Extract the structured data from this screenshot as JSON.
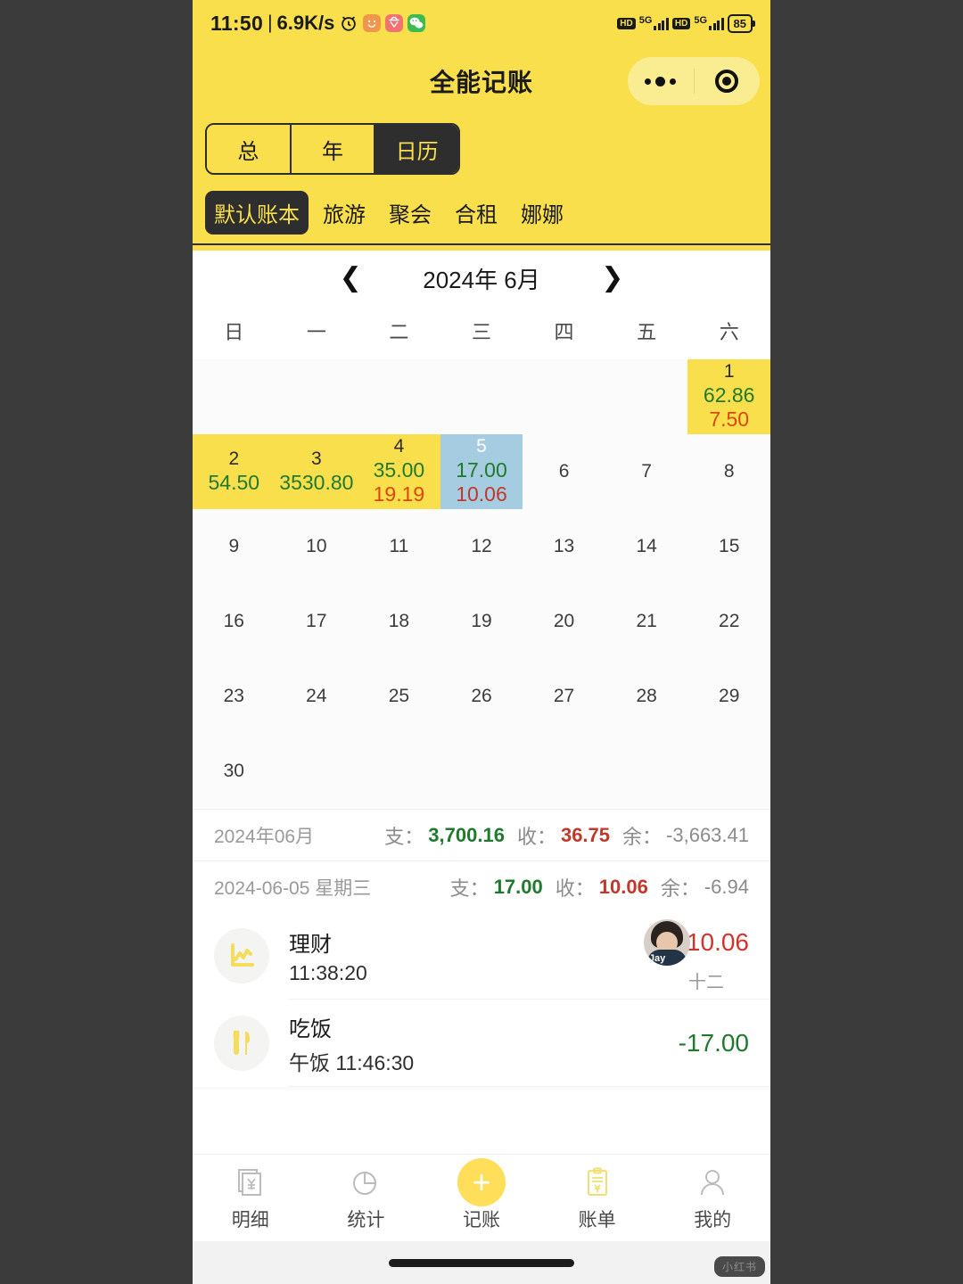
{
  "status_bar": {
    "time": "11:50",
    "separator": "|",
    "net_speed": "6.9K/s",
    "icons": [
      "alarm-clock-icon",
      "orange-app-icon",
      "red-app-icon",
      "wechat-icon"
    ],
    "hd_label": "HD",
    "network_label": "5G",
    "battery": "85"
  },
  "header": {
    "title": "全能记账",
    "capsule": {
      "menu": "more-dots-icon",
      "close": "target-circle-icon"
    },
    "segments": [
      {
        "label": "总",
        "active": false
      },
      {
        "label": "年",
        "active": false
      },
      {
        "label": "日历",
        "active": true
      }
    ],
    "books": [
      {
        "label": "默认账本",
        "active": true
      },
      {
        "label": "旅游",
        "active": false
      },
      {
        "label": "聚会",
        "active": false
      },
      {
        "label": "合租",
        "active": false
      },
      {
        "label": "娜娜",
        "active": false
      }
    ]
  },
  "calendar": {
    "prev_label": "❮",
    "next_label": "❯",
    "month_label": "2024年 6月",
    "weekdays": [
      "日",
      "一",
      "二",
      "三",
      "四",
      "五",
      "六"
    ],
    "cells": [
      {
        "day": "",
        "income": "",
        "expense": "",
        "state": "empty"
      },
      {
        "day": "",
        "income": "",
        "expense": "",
        "state": "empty"
      },
      {
        "day": "",
        "income": "",
        "expense": "",
        "state": "empty"
      },
      {
        "day": "",
        "income": "",
        "expense": "",
        "state": "empty"
      },
      {
        "day": "",
        "income": "",
        "expense": "",
        "state": "empty"
      },
      {
        "day": "",
        "income": "",
        "expense": "",
        "state": "empty"
      },
      {
        "day": "1",
        "income": "62.86",
        "expense": "7.50",
        "state": "hl"
      },
      {
        "day": "2",
        "income": "54.50",
        "expense": "",
        "state": "hl"
      },
      {
        "day": "3",
        "income": "3530.80",
        "expense": "",
        "state": "hl"
      },
      {
        "day": "4",
        "income": "35.00",
        "expense": "19.19",
        "state": "hl"
      },
      {
        "day": "5",
        "income": "17.00",
        "expense": "10.06",
        "state": "sel"
      },
      {
        "day": "6",
        "income": "",
        "expense": "",
        "state": ""
      },
      {
        "day": "7",
        "income": "",
        "expense": "",
        "state": ""
      },
      {
        "day": "8",
        "income": "",
        "expense": "",
        "state": ""
      },
      {
        "day": "9",
        "income": "",
        "expense": "",
        "state": ""
      },
      {
        "day": "10",
        "income": "",
        "expense": "",
        "state": ""
      },
      {
        "day": "11",
        "income": "",
        "expense": "",
        "state": ""
      },
      {
        "day": "12",
        "income": "",
        "expense": "",
        "state": ""
      },
      {
        "day": "13",
        "income": "",
        "expense": "",
        "state": ""
      },
      {
        "day": "14",
        "income": "",
        "expense": "",
        "state": ""
      },
      {
        "day": "15",
        "income": "",
        "expense": "",
        "state": ""
      },
      {
        "day": "16",
        "income": "",
        "expense": "",
        "state": ""
      },
      {
        "day": "17",
        "income": "",
        "expense": "",
        "state": ""
      },
      {
        "day": "18",
        "income": "",
        "expense": "",
        "state": ""
      },
      {
        "day": "19",
        "income": "",
        "expense": "",
        "state": ""
      },
      {
        "day": "20",
        "income": "",
        "expense": "",
        "state": ""
      },
      {
        "day": "21",
        "income": "",
        "expense": "",
        "state": ""
      },
      {
        "day": "22",
        "income": "",
        "expense": "",
        "state": ""
      },
      {
        "day": "23",
        "income": "",
        "expense": "",
        "state": ""
      },
      {
        "day": "24",
        "income": "",
        "expense": "",
        "state": ""
      },
      {
        "day": "25",
        "income": "",
        "expense": "",
        "state": ""
      },
      {
        "day": "26",
        "income": "",
        "expense": "",
        "state": ""
      },
      {
        "day": "27",
        "income": "",
        "expense": "",
        "state": ""
      },
      {
        "day": "28",
        "income": "",
        "expense": "",
        "state": ""
      },
      {
        "day": "29",
        "income": "",
        "expense": "",
        "state": ""
      },
      {
        "day": "30",
        "income": "",
        "expense": "",
        "state": ""
      },
      {
        "day": "",
        "income": "",
        "expense": "",
        "state": "empty"
      },
      {
        "day": "",
        "income": "",
        "expense": "",
        "state": "empty"
      },
      {
        "day": "",
        "income": "",
        "expense": "",
        "state": "empty"
      },
      {
        "day": "",
        "income": "",
        "expense": "",
        "state": "empty"
      },
      {
        "day": "",
        "income": "",
        "expense": "",
        "state": "empty"
      },
      {
        "day": "",
        "income": "",
        "expense": "",
        "state": "empty"
      }
    ]
  },
  "month_summary": {
    "date": "2024年06月",
    "expense_label": "支：",
    "expense_value": "3,700.16",
    "income_label": "收：",
    "income_value": "36.75",
    "balance_label": "余：",
    "balance_value": "-3,663.41"
  },
  "day_summary": {
    "date": "2024-06-05 星期三",
    "expense_label": "支：",
    "expense_value": "17.00",
    "income_label": "收：",
    "income_value": "10.06",
    "balance_label": "余：",
    "balance_value": "-6.94"
  },
  "transactions": [
    {
      "icon": "line-chart-icon",
      "name": "理财",
      "sub": "11:38:20",
      "amount": "10.06",
      "amount_type": "income",
      "avatar_tag": "Jay",
      "note": "十二"
    },
    {
      "icon": "cutlery-icon",
      "name": "吃饭",
      "sub": "午饭 11:46:30",
      "amount": "-17.00",
      "amount_type": "expense",
      "avatar_tag": "",
      "note": ""
    }
  ],
  "tabbar": [
    {
      "icon": "receipt-yen-icon",
      "label": "明细",
      "active": false
    },
    {
      "icon": "pie-chart-icon",
      "label": "统计",
      "active": false
    },
    {
      "icon": "plus-icon",
      "label": "记账",
      "active": true
    },
    {
      "icon": "clipboard-yen-icon",
      "label": "账单",
      "active": false
    },
    {
      "icon": "person-icon",
      "label": "我的",
      "active": false
    }
  ],
  "watermark": {
    "text": "小红书"
  },
  "colors": {
    "brand_yellow": "#F8DF4B",
    "dark": "#2e2e2e",
    "income_red": "#C0392B",
    "expense_green": "#1f7a2e",
    "selected_blue": "#A5CCE0"
  }
}
